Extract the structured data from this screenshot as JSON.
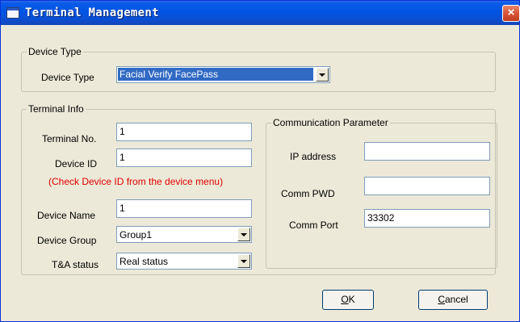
{
  "window": {
    "title": "Terminal Management",
    "close_glyph": "×"
  },
  "device_type_group": {
    "title": "Device Type",
    "label": "Device Type",
    "selected": "Facial Verify FacePass"
  },
  "terminal_info_group": {
    "title": "Terminal Info",
    "terminal_no": {
      "label": "Terminal No.",
      "value": "1"
    },
    "device_id": {
      "label": "Device ID",
      "value": "1",
      "hint": "(Check Device ID from the device menu)"
    },
    "device_name": {
      "label": "Device Name",
      "value": "1"
    },
    "device_group": {
      "label": "Device Group",
      "selected": "Group1"
    },
    "ta_status": {
      "label": "T&A status",
      "selected": "Real status"
    }
  },
  "comm_group": {
    "title": "Communication Parameter",
    "ip_address": {
      "label": "IP address",
      "value": ""
    },
    "comm_pwd": {
      "label": "Comm PWD",
      "value": ""
    },
    "comm_port": {
      "label": "Comm Port",
      "value": "33302"
    }
  },
  "buttons": {
    "ok": {
      "mnemonic": "O",
      "rest": "K"
    },
    "cancel": {
      "mnemonic": "C",
      "rest": "ancel"
    }
  },
  "colors": {
    "hint_text": "#E00000",
    "selection": "#316AC5",
    "title_bar": "#0054E3"
  },
  "icons": {
    "window_icon": "window-icon",
    "dropdown": "chevron-down-icon"
  }
}
